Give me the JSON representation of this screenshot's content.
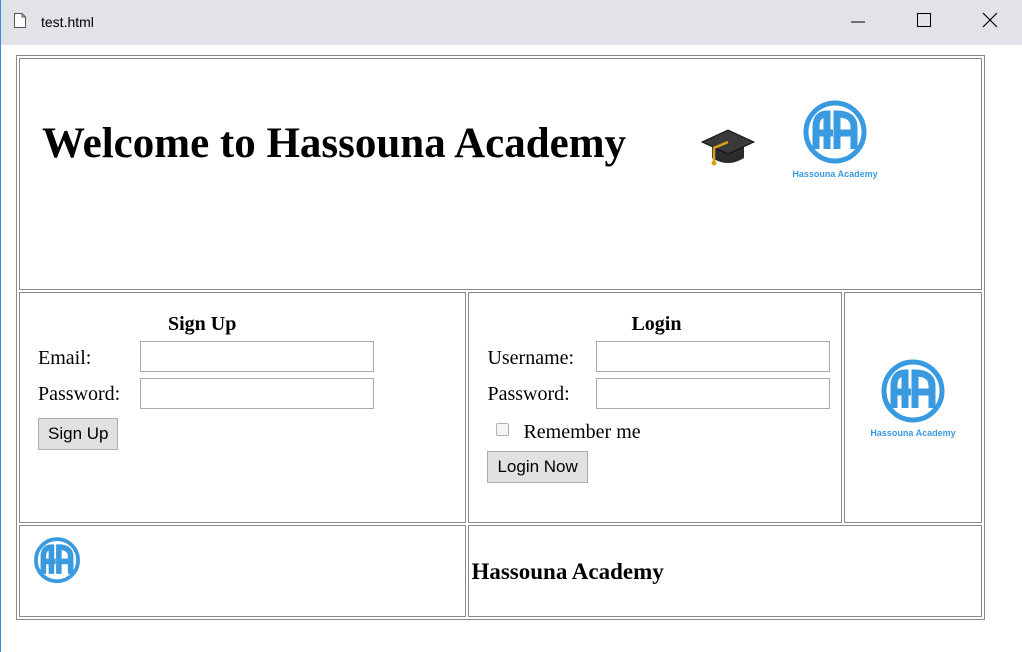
{
  "window": {
    "title": "test.html",
    "icons": [
      "document-icon",
      "minimize-icon",
      "maximize-icon",
      "close-icon"
    ]
  },
  "header": {
    "heading": "Welcome to Hassouna Academy",
    "emoji_icon": "graduation-cap-icon",
    "logo_caption": "Hassouna Academy"
  },
  "signup": {
    "title": "Sign Up",
    "email_label": "Email:",
    "email_value": "",
    "password_label": "Password:",
    "password_value": "",
    "button_label": "Sign Up"
  },
  "login": {
    "title": "Login",
    "username_label": "Username:",
    "username_value": "",
    "password_label": "Password:",
    "password_value": "",
    "remember_label": "Remember me",
    "remember_checked": false,
    "button_label": "Login Now"
  },
  "side_logo": {
    "caption": "Hassouna Academy"
  },
  "footer": {
    "title": "Hassouna Academy"
  },
  "colors": {
    "logo_blue": "#3a9ae0",
    "titlebar_bg": "#e1e3e8",
    "button_bg": "#e1e1e1"
  }
}
